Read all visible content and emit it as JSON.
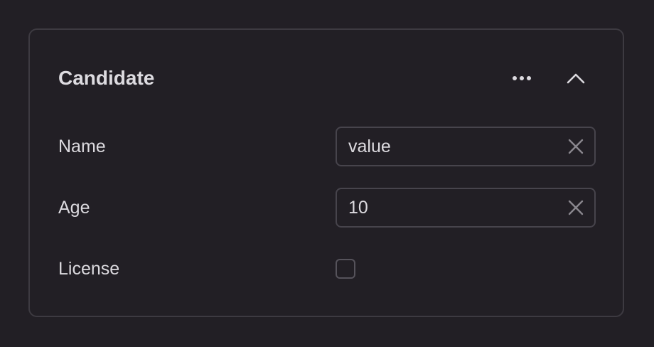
{
  "card": {
    "title": "Candidate",
    "more_icon": "more-horizontal-icon",
    "collapse_icon": "chevron-up-icon"
  },
  "fields": {
    "name": {
      "label": "Name",
      "value": "value",
      "clear_icon": "close-icon"
    },
    "age": {
      "label": "Age",
      "value": "10",
      "clear_icon": "close-icon"
    },
    "license": {
      "label": "License",
      "checked": false
    }
  },
  "colors": {
    "background": "#221f25",
    "border": "#3d3a41",
    "text": "#dcdadf",
    "icon": "#8a878e"
  }
}
